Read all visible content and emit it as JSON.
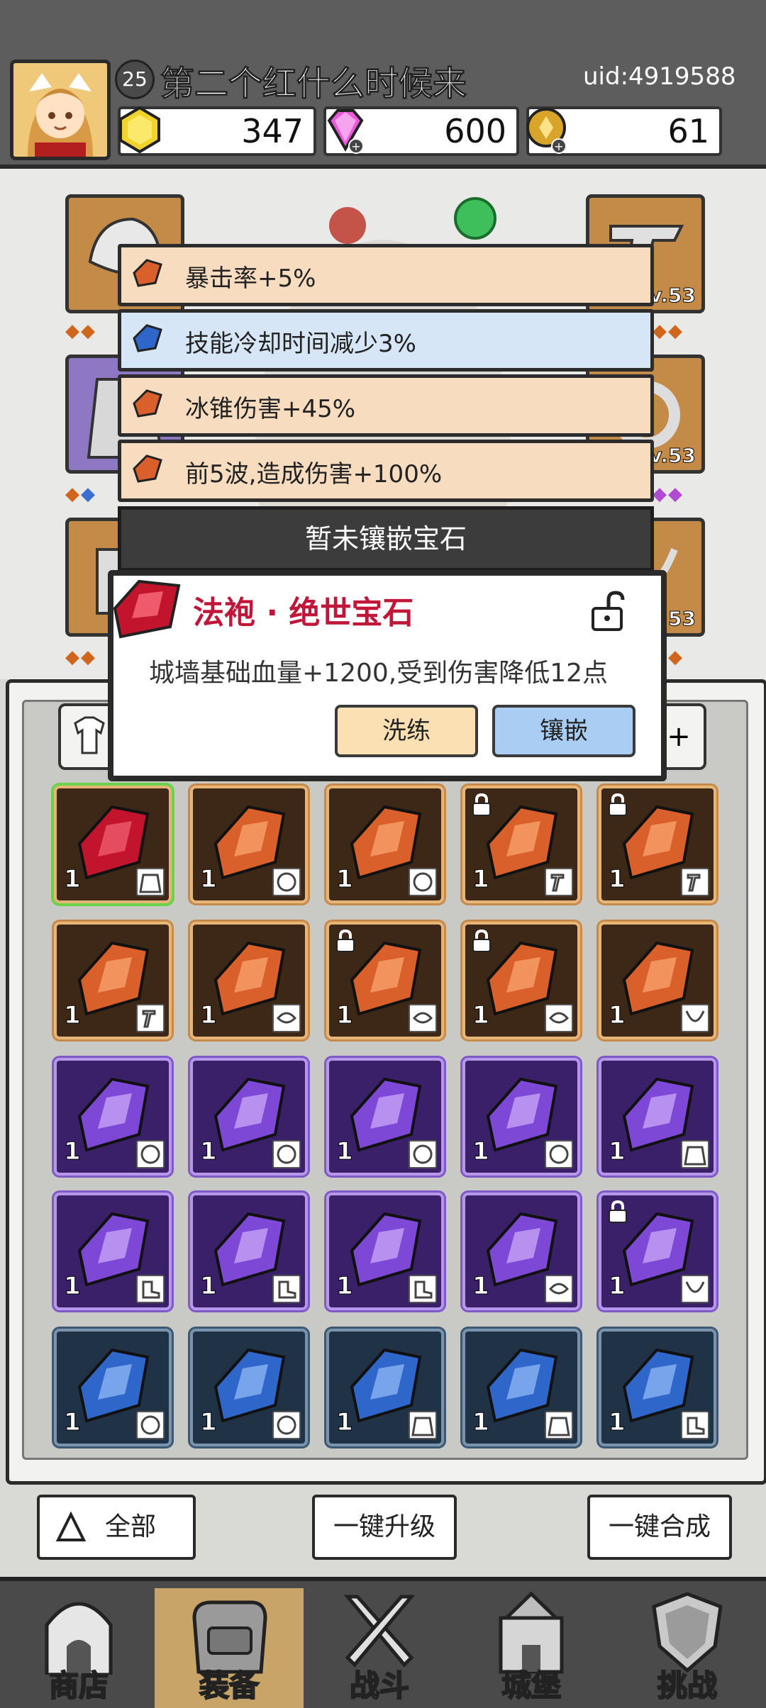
{
  "header": {
    "level": "25",
    "username": "第二个红什么时候来",
    "uid": "uid:4919588",
    "currencies": [
      {
        "name": "gold-icon",
        "value": "347",
        "color": "#f2d22c"
      },
      {
        "name": "diamond-icon",
        "value": "600",
        "color": "#e85ad8"
      },
      {
        "name": "coin-icon",
        "value": "61",
        "color": "#d9a42a"
      }
    ]
  },
  "equipment": {
    "slot_levels": [
      "Lv.53",
      "Lv.53",
      "Lv.53"
    ]
  },
  "attributes": [
    {
      "text": "暴击率+5%",
      "gem": "orange"
    },
    {
      "text": "技能冷却时间减少3%",
      "gem": "blue"
    },
    {
      "text": "冰锥伤害+45%",
      "gem": "orange"
    },
    {
      "text": "前5波,造成伤害+100%",
      "gem": "orange"
    }
  ],
  "empty_slot_text": "暂未镶嵌宝石",
  "gem_popup": {
    "title": "法袍 · 绝世宝石",
    "description": "城墙基础血量+1200,受到伤害降低12点",
    "wash_label": "洗练",
    "inlay_label": "镶嵌"
  },
  "inventory": {
    "plus_label": "+",
    "items": [
      {
        "color": "red",
        "qty": "1",
        "locked": false,
        "type": "robe"
      },
      {
        "color": "orange",
        "qty": "1",
        "locked": false,
        "type": "ring"
      },
      {
        "color": "orange",
        "qty": "1",
        "locked": false,
        "type": "ring"
      },
      {
        "color": "orange",
        "qty": "1",
        "locked": true,
        "type": "staff"
      },
      {
        "color": "orange",
        "qty": "1",
        "locked": true,
        "type": "staff"
      },
      {
        "color": "orange",
        "qty": "1",
        "locked": false,
        "type": "staff"
      },
      {
        "color": "orange",
        "qty": "1",
        "locked": false,
        "type": "bracelet"
      },
      {
        "color": "orange",
        "qty": "1",
        "locked": true,
        "type": "bracelet"
      },
      {
        "color": "orange",
        "qty": "1",
        "locked": true,
        "type": "bracelet"
      },
      {
        "color": "orange",
        "qty": "1",
        "locked": false,
        "type": "necklace"
      },
      {
        "color": "purple",
        "qty": "1",
        "locked": false,
        "type": "ring"
      },
      {
        "color": "purple",
        "qty": "1",
        "locked": false,
        "type": "ring"
      },
      {
        "color": "purple",
        "qty": "1",
        "locked": false,
        "type": "ring"
      },
      {
        "color": "purple",
        "qty": "1",
        "locked": false,
        "type": "ring"
      },
      {
        "color": "purple",
        "qty": "1",
        "locked": false,
        "type": "robe"
      },
      {
        "color": "purple",
        "qty": "1",
        "locked": false,
        "type": "boots"
      },
      {
        "color": "purple",
        "qty": "1",
        "locked": false,
        "type": "boots"
      },
      {
        "color": "purple",
        "qty": "1",
        "locked": false,
        "type": "boots"
      },
      {
        "color": "purple",
        "qty": "1",
        "locked": false,
        "type": "bracelet"
      },
      {
        "color": "purple",
        "qty": "1",
        "locked": true,
        "type": "necklace"
      },
      {
        "color": "blue",
        "qty": "1",
        "locked": false,
        "type": "ring"
      },
      {
        "color": "blue",
        "qty": "1",
        "locked": false,
        "type": "ring"
      },
      {
        "color": "blue",
        "qty": "1",
        "locked": false,
        "type": "robe"
      },
      {
        "color": "blue",
        "qty": "1",
        "locked": false,
        "type": "robe"
      },
      {
        "color": "blue",
        "qty": "1",
        "locked": false,
        "type": "boots"
      }
    ]
  },
  "actions": {
    "all_label": "全部",
    "upgrade_label": "一键升级",
    "merge_label": "一键合成"
  },
  "nav": [
    {
      "label": "商店",
      "icon": "shop-icon",
      "active": false
    },
    {
      "label": "装备",
      "icon": "bag-icon",
      "active": true
    },
    {
      "label": "战斗",
      "icon": "swords-icon",
      "active": false
    },
    {
      "label": "城堡",
      "icon": "castle-icon",
      "active": false
    },
    {
      "label": "挑战",
      "icon": "shield-icon",
      "active": false
    }
  ]
}
